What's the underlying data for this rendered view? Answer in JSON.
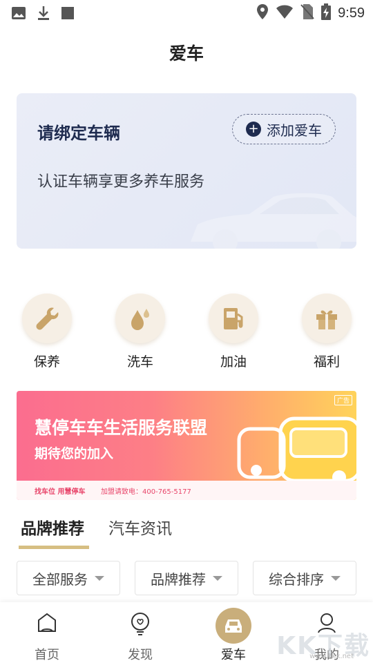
{
  "status_bar": {
    "time": "9:59"
  },
  "header": {
    "title": "爱车"
  },
  "bind_card": {
    "title": "请绑定车辆",
    "add_button_label": "添加爱车",
    "subtitle": "认证车辆享更多养车服务"
  },
  "services": [
    {
      "label": "保养",
      "icon": "wrench-icon"
    },
    {
      "label": "洗车",
      "icon": "water-drop-icon"
    },
    {
      "label": "加油",
      "icon": "fuel-pump-icon"
    },
    {
      "label": "福利",
      "icon": "gift-icon"
    }
  ],
  "banner": {
    "headline": "慧停车车生活服务联盟",
    "subline": "期待您的加入",
    "footer_left": "找车位 用慧停车",
    "footer_right": "加盟请致电：400-765-5177",
    "ad_tag": "广告"
  },
  "tabs": [
    {
      "label": "品牌推荐",
      "active": true
    },
    {
      "label": "汽车资讯",
      "active": false
    }
  ],
  "filters": [
    {
      "label": "全部服务"
    },
    {
      "label": "品牌推荐"
    },
    {
      "label": "综合排序"
    }
  ],
  "bottom_nav": [
    {
      "label": "首页",
      "icon": "home-icon"
    },
    {
      "label": "发现",
      "icon": "discover-icon"
    },
    {
      "label": "爱车",
      "icon": "car-icon",
      "active": true
    },
    {
      "label": "我的",
      "icon": "profile-icon"
    }
  ],
  "watermark": {
    "text": "KK下载",
    "sub": "www.kkx.net"
  },
  "colors": {
    "accent_gold": "#c9ae7b",
    "navy": "#1e2b4f",
    "tab_indicator": "#d6be82"
  }
}
